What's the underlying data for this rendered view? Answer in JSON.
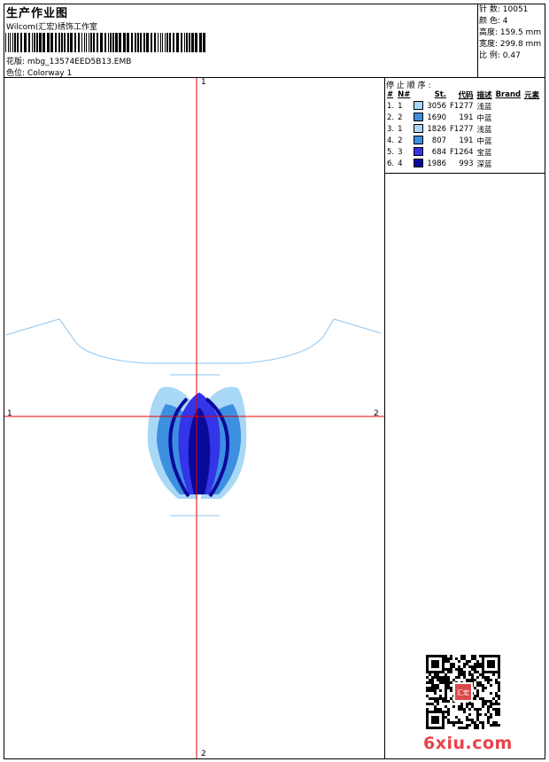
{
  "header": {
    "title": "生产作业图",
    "company": "Wilcom(汇宏)绣饰工作室",
    "design_name_label": "花版:",
    "design_name": "mbg_13574EED5B13.EMB",
    "colorway_label": "色位:",
    "colorway": "Colorway 1"
  },
  "stats": {
    "stitches_label": "针 数:",
    "stitches": "10051",
    "colors_label": "颜 色:",
    "colors": "4",
    "height_label": "高度:",
    "height": "159.5 mm",
    "width_label": "宽度:",
    "width": "299.8 mm",
    "scale_label": "比 例:",
    "scale": "0.47"
  },
  "stop_sequence": {
    "title": "停 止 顺 序 :",
    "headers": [
      "#",
      "N#",
      "St.",
      "代码",
      "描述",
      "Brand",
      "元素"
    ],
    "rows": [
      {
        "seq": "1.",
        "n": "1",
        "color": "#a9d8f6",
        "st": "3056",
        "code": "F1277",
        "desc": "浅蓝"
      },
      {
        "seq": "2.",
        "n": "2",
        "color": "#3d8fe0",
        "st": "1690",
        "code": "191",
        "desc": "中蓝"
      },
      {
        "seq": "3.",
        "n": "1",
        "color": "#a9d8f6",
        "st": "1826",
        "code": "F1277",
        "desc": "浅蓝"
      },
      {
        "seq": "4.",
        "n": "2",
        "color": "#3d8fe0",
        "st": "807",
        "code": "191",
        "desc": "中蓝"
      },
      {
        "seq": "5.",
        "n": "3",
        "color": "#3434e8",
        "st": "684",
        "code": "F1264",
        "desc": "宝蓝"
      },
      {
        "seq": "6.",
        "n": "4",
        "color": "#0a0a9a",
        "st": "1986",
        "code": "993",
        "desc": "深蓝"
      }
    ]
  },
  "design_view": {
    "axis_labels": {
      "top": "1",
      "bottom": "2",
      "left": "1",
      "right": "2"
    },
    "crosshair_color": "#e00000",
    "outline_color": "#8fc6f0"
  },
  "watermark": "6xiu.com",
  "qr_seal_text": "汇宏"
}
